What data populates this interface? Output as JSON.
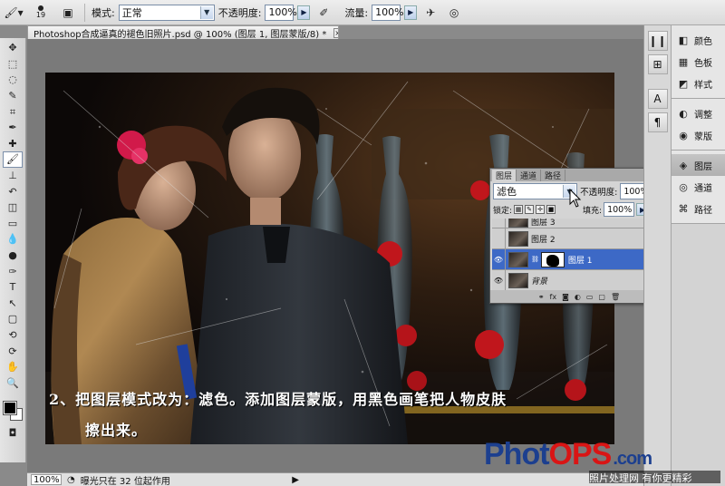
{
  "options_bar": {
    "brush_size": "19",
    "mode_label": "模式:",
    "mode_value": "正常",
    "opacity_label": "不透明度:",
    "opacity_value": "100%",
    "flow_label": "流量:",
    "flow_value": "100%"
  },
  "document": {
    "tab_title": "Photoshop合成逼真的褪色旧照片.psd @ 100% (图层 1, 图层蒙版/8) *",
    "close_glyph": "×"
  },
  "tools": [
    "move-tool",
    "marquee-tool",
    "lasso-tool",
    "quick-select-tool",
    "crop-tool",
    "eyedropper-tool",
    "healing-tool",
    "brush-tool",
    "clone-stamp-tool",
    "history-brush-tool",
    "eraser-tool",
    "gradient-tool",
    "blur-tool",
    "dodge-tool",
    "pen-tool",
    "type-tool",
    "path-select-tool",
    "shape-tool",
    "3d-rotate-tool",
    "3d-orbit-tool",
    "hand-tool",
    "zoom-tool"
  ],
  "tool_glyphs": [
    "✥",
    "⬚",
    "◌",
    "✎",
    "⌗",
    "✒",
    "✚",
    "🖌",
    "⊥",
    "↶",
    "◫",
    "▭",
    "💧",
    "●",
    "✑",
    "T",
    "↖",
    "▢",
    "⟲",
    "⟳",
    "✋",
    "🔍"
  ],
  "selected_tool_index": 7,
  "right_dock": {
    "group1": [
      {
        "icon": "color-icon",
        "glyph": "◧",
        "label": "颜色"
      },
      {
        "icon": "swatches-icon",
        "glyph": "▦",
        "label": "色板"
      },
      {
        "icon": "styles-icon",
        "glyph": "◩",
        "label": "样式"
      }
    ],
    "group2": [
      {
        "icon": "adjustments-icon",
        "glyph": "◐",
        "label": "调整"
      },
      {
        "icon": "masks-icon",
        "glyph": "◉",
        "label": "蒙版"
      }
    ],
    "group3": [
      {
        "icon": "layers-icon",
        "glyph": "◈",
        "label": "图层"
      },
      {
        "icon": "channels-icon",
        "glyph": "◎",
        "label": "通道"
      },
      {
        "icon": "paths-icon",
        "glyph": "⌘",
        "label": "路径"
      }
    ]
  },
  "layers_panel": {
    "tabs": [
      "图层",
      "通道",
      "路径"
    ],
    "blend_mode": "滤色",
    "opacity_label": "不透明度:",
    "opacity_value": "100%",
    "lock_label": "锁定:",
    "fill_label": "填充:",
    "fill_value": "100%",
    "layers": [
      {
        "name": "图层 3",
        "visible": false,
        "selected": false,
        "has_mask": false,
        "partial": true
      },
      {
        "name": "图层 2",
        "visible": false,
        "selected": false,
        "has_mask": false
      },
      {
        "name": "图层 1",
        "visible": true,
        "selected": true,
        "has_mask": true
      },
      {
        "name": "背景",
        "visible": true,
        "selected": false,
        "has_mask": false,
        "locked": true
      }
    ]
  },
  "status_bar": {
    "zoom": "100%",
    "info": "曝光只在 32 位起作用"
  },
  "tutorial_text": {
    "line1": "2、把图层模式改为：滤色。添加图层蒙版，用黑色画笔把人物皮肤",
    "line2": "擦出来。"
  },
  "watermark": {
    "part1": "Phot",
    "part2": "OPS",
    "part3": ".com",
    "slogan": "照片处理网 有你更精彩"
  },
  "colors": {
    "selection_blue": "#3d69c6",
    "watermark_red": "#d91515",
    "watermark_blue": "#1c3f8f"
  }
}
